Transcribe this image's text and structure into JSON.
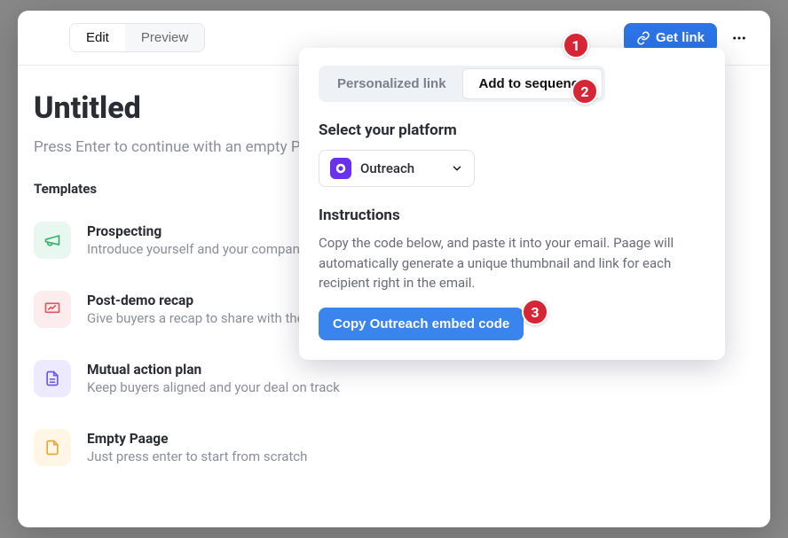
{
  "topbar": {
    "edit_label": "Edit",
    "preview_label": "Preview",
    "getlink_label": "Get link"
  },
  "page": {
    "title": "Untitled",
    "subtitle": "Press Enter to continue with an empty Paage",
    "templates_heading": "Templates"
  },
  "templates": [
    {
      "title": "Prospecting",
      "desc": "Introduce yourself and your company"
    },
    {
      "title": "Post-demo recap",
      "desc": "Give buyers a recap to share with their team"
    },
    {
      "title": "Mutual action plan",
      "desc": "Keep buyers aligned and your deal on track"
    },
    {
      "title": "Empty Paage",
      "desc": "Just press enter to start from scratch"
    }
  ],
  "popover": {
    "tab_personalized": "Personalized link",
    "tab_sequence": "Add to sequence",
    "platform_label": "Select your platform",
    "platform_selected": "Outreach",
    "instructions_heading": "Instructions",
    "instructions_body": "Copy the code below, and paste it into your email. Paage will automatically generate a unique thumbnail and link for each recipient right in the email.",
    "copy_button": "Copy Outreach embed code"
  },
  "annotations": [
    "1",
    "2",
    "3"
  ]
}
